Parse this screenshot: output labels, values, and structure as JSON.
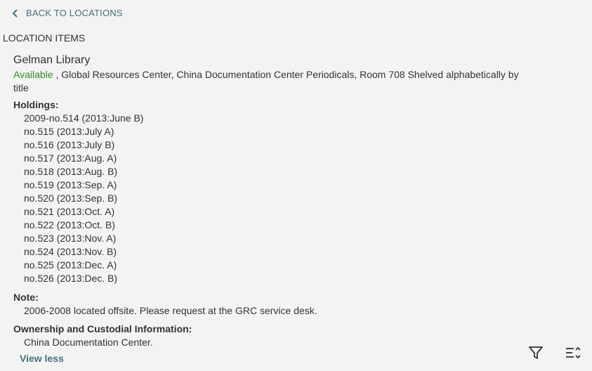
{
  "nav": {
    "back_label": "BACK TO LOCATIONS",
    "back_icon": "chevron-left-icon"
  },
  "section_title": "LOCATION ITEMS",
  "location": {
    "name": "Gelman Library",
    "availability": "Available",
    "details": ", Global Resources Center, China Documentation Center Periodicals, Room 708 Shelved alphabetically by title",
    "holdings_label": "Holdings:",
    "holdings": [
      "2009-no.514 (2013:June B)",
      "no.515 (2013:July A)",
      "no.516 (2013:July B)",
      "no.517 (2013:Aug. A)",
      "no.518 (2013:Aug. B)",
      "no.519 (2013:Sep. A)",
      "no.520 (2013:Sep. B)",
      "no.521 (2013:Oct. A)",
      "no.522 (2013:Oct. B)",
      "no.523 (2013:Nov. A)",
      "no.524 (2013:Nov. B)",
      "no.525 (2013:Dec. A)",
      "no.526 (2013:Dec. B)"
    ],
    "note_label": "Note:",
    "note": "2006-2008 located offsite. Please request at the GRC service desk.",
    "ownership_label": "Ownership and Custodial Information:",
    "ownership": "China Documentation Center."
  },
  "view_less_label": "View less",
  "toolbar": {
    "filter_icon": "filter-icon",
    "sort_icon": "sort-icon"
  },
  "colors": {
    "background": "#f3f3f3",
    "link": "#44707b",
    "available": "#2e8b1f",
    "text": "#333333"
  }
}
